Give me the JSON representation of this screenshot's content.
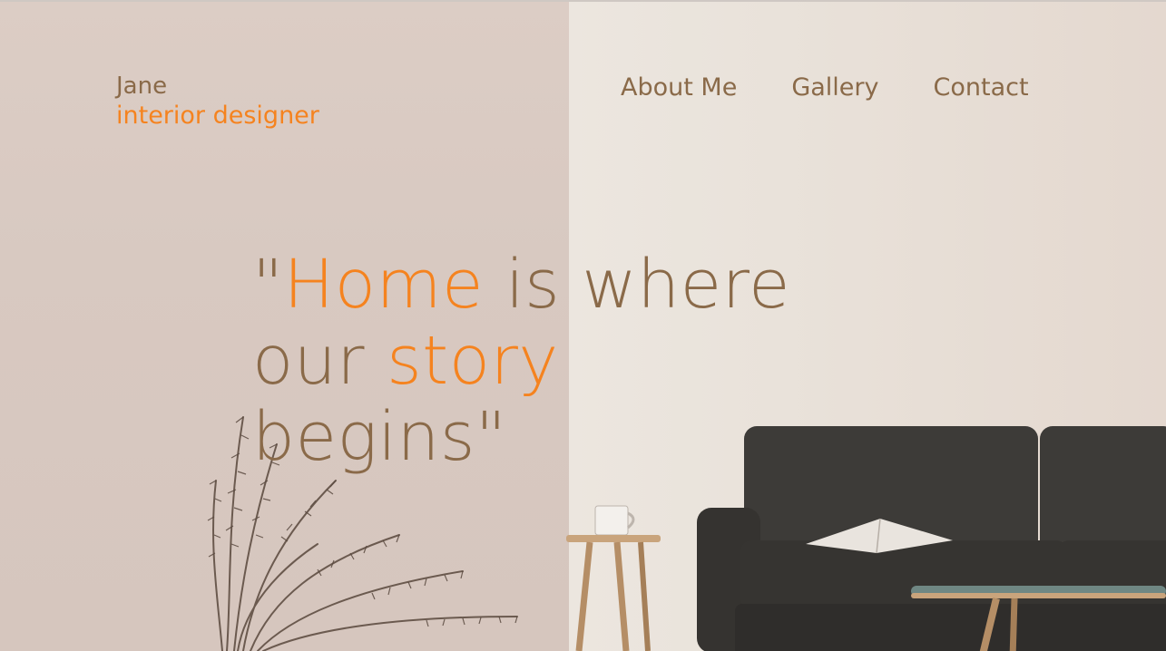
{
  "brand": {
    "name": "Jane",
    "tagline": "interior designer"
  },
  "nav": {
    "items": [
      {
        "label": "About Me"
      },
      {
        "label": "Gallery"
      },
      {
        "label": "Contact"
      }
    ]
  },
  "hero": {
    "quote_open": "\"",
    "word_home": "Home",
    "text_is_where": " is where",
    "text_our": "our ",
    "word_story": "story",
    "text_begins": "begins\""
  },
  "colors": {
    "brand_brown": "#8a6a49",
    "accent_orange": "#f5831f",
    "sofa": "#3b3936"
  },
  "icons": {
    "plant": "dried-plant-illustration",
    "sofa": "sofa-illustration",
    "side_table": "side-table-with-mug-illustration",
    "coffee_table": "coffee-table-illustration"
  }
}
